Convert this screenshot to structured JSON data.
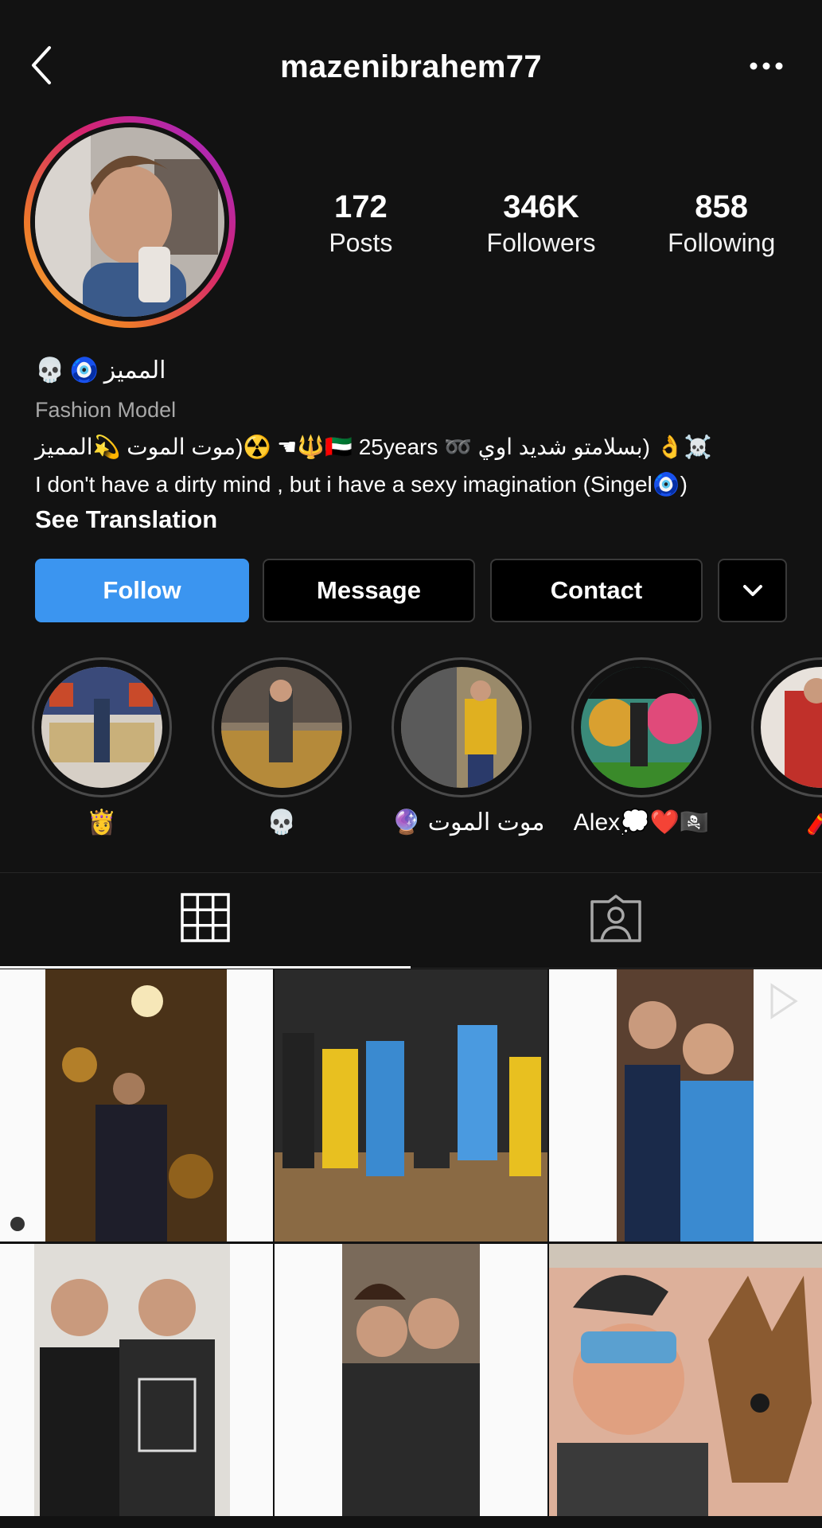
{
  "header": {
    "username": "mazenibrahem77",
    "back_icon": "chevron-left-icon",
    "more_icon": "more-horizontal-icon"
  },
  "profile": {
    "stats": [
      {
        "value": "172",
        "label": "Posts"
      },
      {
        "value": "346K",
        "label": "Followers"
      },
      {
        "value": "858",
        "label": "Following"
      }
    ],
    "display_name": "المميز",
    "category": "Fashion Model",
    "bio_line_1": "☠️👌 (بسلامتو شديد اوي ➿ 🇦🇪 25years🔱☚ ☢️(موت الموت 💫المميز",
    "bio_line_2": "I don't have a dirty mind , but i have a sexy imagination (Singel🧿)",
    "see_translation": "See Translation"
  },
  "buttons": {
    "follow": "Follow",
    "message": "Message",
    "contact": "Contact",
    "dropdown_icon": "chevron-down-icon"
  },
  "highlights": [
    {
      "label": "👸"
    },
    {
      "label": "💀"
    },
    {
      "label": "🔮 موت الموت"
    },
    {
      "label": "Alex💭❤️🏴‍☠️"
    },
    {
      "label": "🧨"
    }
  ],
  "tabs": {
    "grid_icon": "grid-icon",
    "tagged_icon": "tagged-person-icon"
  },
  "colors": {
    "background": "#121212",
    "accent": "#3b95f0",
    "muted": "#a8a8a8"
  }
}
